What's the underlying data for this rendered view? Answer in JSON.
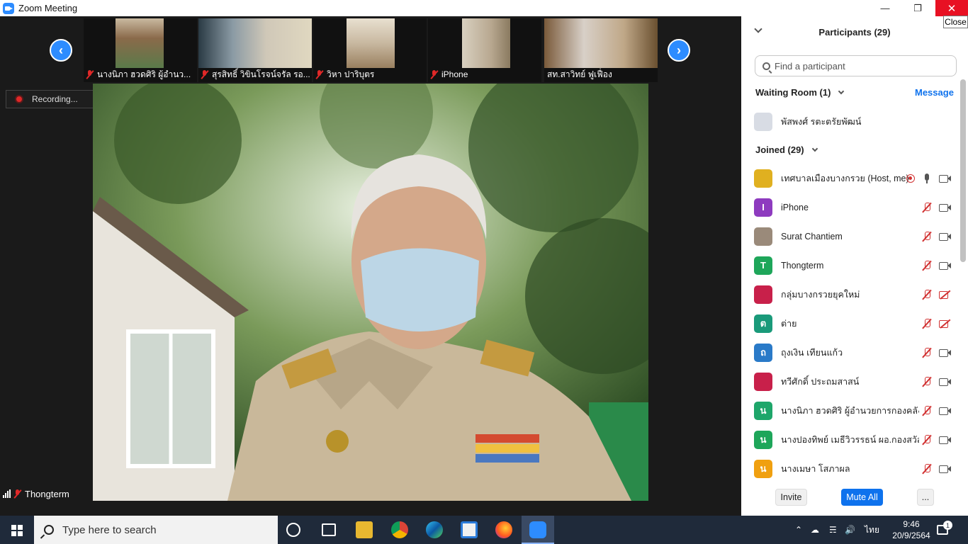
{
  "window": {
    "title": "Zoom Meeting",
    "close_tooltip": "Close"
  },
  "thumbnails": [
    {
      "name": "นางนิภา ฮวดศิริ  ผู้อำนว...",
      "muted": true
    },
    {
      "name": "สุรสิทธิ์ วิขินโรจน์จรัล รอ...",
      "muted": true
    },
    {
      "name": "วิหา ปาริบุตร",
      "muted": true
    },
    {
      "name": "iPhone",
      "muted": true
    },
    {
      "name": "สท.สาวิทย์  ฟูเฟื่อง",
      "muted": false
    }
  ],
  "recording": {
    "label": "Recording..."
  },
  "active_speaker": {
    "name": "Thongterm"
  },
  "panel": {
    "title": "Participants (29)",
    "search_placeholder": "Find a participant",
    "waiting_room": {
      "title": "Waiting Room (1)",
      "message_label": "Message",
      "person": "พัสพงศ์ รตะตรัยพัฒน์"
    },
    "joined_title": "Joined (29)",
    "participants": [
      {
        "name": "เทศบาลเมืองบางกรวย (Host, me)",
        "initial": "",
        "color": "#e0b020",
        "mic": "on",
        "cam": "on",
        "rec": true
      },
      {
        "name": "iPhone",
        "initial": "I",
        "color": "#8e3bbf",
        "mic": "off",
        "cam": "on"
      },
      {
        "name": "Surat Chantiem",
        "initial": "",
        "color": "#9a8a7a",
        "mic": "off",
        "cam": "on"
      },
      {
        "name": "Thongterm",
        "initial": "T",
        "color": "#1ea65a",
        "mic": "off",
        "cam": "on"
      },
      {
        "name": "กลุ่มบางกรวยยุคใหม่",
        "initial": "",
        "color": "#c8204a",
        "mic": "off",
        "cam": "off"
      },
      {
        "name": "ต่าย",
        "initial": "ต",
        "color": "#1a9a7a",
        "mic": "off",
        "cam": "off"
      },
      {
        "name": "ถุงเงิน เทียนแก้ว",
        "initial": "ถ",
        "color": "#2a7ac8",
        "mic": "off",
        "cam": "on"
      },
      {
        "name": "ทวีศักดิ์ ประถมสาสน์",
        "initial": "",
        "color": "#c8204a",
        "mic": "off",
        "cam": "on"
      },
      {
        "name": "นางนิภา ฮวดศิริ  ผู้อำนวยการกองคลัง",
        "initial": "น",
        "color": "#1ea66a",
        "mic": "off",
        "cam": "on"
      },
      {
        "name": "นางปองทิพย์ เมธีวิวรรธน์ ผอ.กองสวัส...",
        "initial": "น",
        "color": "#1ea65a",
        "mic": "off",
        "cam": "on"
      },
      {
        "name": "นางเมษา  โสภาผล",
        "initial": "น",
        "color": "#f0a010",
        "mic": "off",
        "cam": "on"
      }
    ],
    "footer": {
      "invite": "Invite",
      "mute_all": "Mute All",
      "more": "..."
    }
  },
  "taskbar": {
    "search_placeholder": "Type here to search",
    "lang": "ไทย",
    "time": "9:46",
    "date": "20/9/2564",
    "notifications": "1"
  },
  "icons": {
    "nav_left": "chevron-left-icon",
    "nav_right": "chevron-right-icon",
    "mic_muted": "mic-muted-icon",
    "camera": "video-camera-icon"
  }
}
